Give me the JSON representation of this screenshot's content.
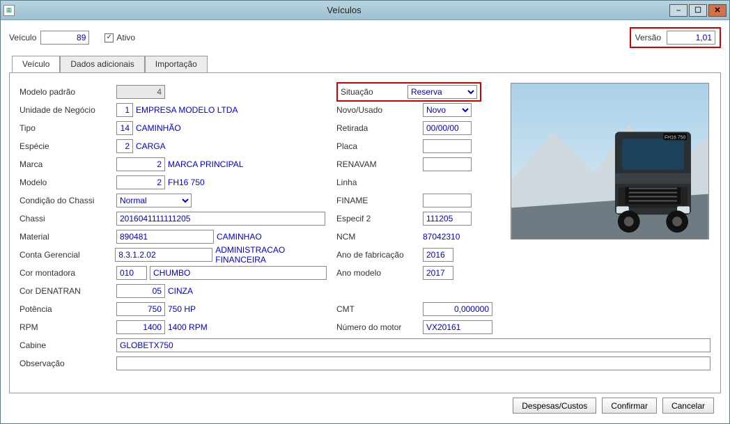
{
  "window": {
    "title": "Veículos"
  },
  "top": {
    "veiculo_label": "Veículo",
    "veiculo_value": "89",
    "ativo_label": "Ativo",
    "ativo_checked": "✓",
    "versao_label": "Versão",
    "versao_value": "1,01"
  },
  "tabs": {
    "veiculo": "Veículo",
    "dados": "Dados adicionais",
    "importacao": "Importação"
  },
  "left": {
    "modelo_padrao_label": "Modelo padrão",
    "modelo_padrao_value": "4",
    "unidade_label": "Unidade de Negócio",
    "unidade_code": "1",
    "unidade_name": "EMPRESA MODELO LTDA",
    "tipo_label": "Tipo",
    "tipo_code": "14",
    "tipo_name": "CAMINHÃO",
    "especie_label": "Espécie",
    "especie_code": "2",
    "especie_name": "CARGA",
    "marca_label": "Marca",
    "marca_code": "2",
    "marca_name": "MARCA PRINCIPAL",
    "modelo_label": "Modelo",
    "modelo_code": "2",
    "modelo_name": "FH16 750",
    "condicao_label": "Condição do Chassi",
    "condicao_value": "Normal",
    "chassi_label": "Chassi",
    "chassi_value": "2016041111111205",
    "material_label": "Material",
    "material_code": "890481",
    "material_name": "CAMINHAO",
    "conta_label": "Conta Gerencial",
    "conta_code": "8.3.1.2.02",
    "conta_name": "ADMINISTRACAO  FINANCEIRA",
    "cor_montadora_label": "Cor montadora",
    "cor_montadora_code": "010",
    "cor_montadora_name": "CHUMBO",
    "cor_denatran_label": "Cor DENATRAN",
    "cor_denatran_code": "05",
    "cor_denatran_name": "CINZA",
    "potencia_label": "Potência",
    "potencia_code": "750",
    "potencia_name": "750 HP",
    "rpm_label": "RPM",
    "rpm_code": "1400",
    "rpm_name": "1400 RPM",
    "cabine_label": "Cabine",
    "cabine_value": "GLOBETX750",
    "observacao_label": "Observação",
    "observacao_value": ""
  },
  "mid": {
    "situacao_label": "Situação",
    "situacao_value": "Reserva",
    "novo_label": "Novo/Usado",
    "novo_value": "Novo",
    "retirada_label": "Retirada",
    "retirada_value": "00/00/00",
    "placa_label": "Placa",
    "placa_value": "",
    "renavam_label": "RENAVAM",
    "renavam_value": "",
    "linha_label": "Linha",
    "finame_label": "FINAME",
    "finame_value": "",
    "especif2_label": "Especif 2",
    "especif2_value": "111205",
    "ncm_label": "NCM",
    "ncm_value": "87042310",
    "ano_fab_label": "Ano de fabricação",
    "ano_fab_value": "2016",
    "ano_mod_label": "Ano modelo",
    "ano_mod_value": "2017",
    "cmt_label": "CMT",
    "cmt_value": "0,000000",
    "motor_label": "Número do motor",
    "motor_value": "VX20161"
  },
  "footer": {
    "despesas": "Despesas/Custos",
    "confirmar": "Confirmar",
    "cancelar": "Cancelar"
  }
}
